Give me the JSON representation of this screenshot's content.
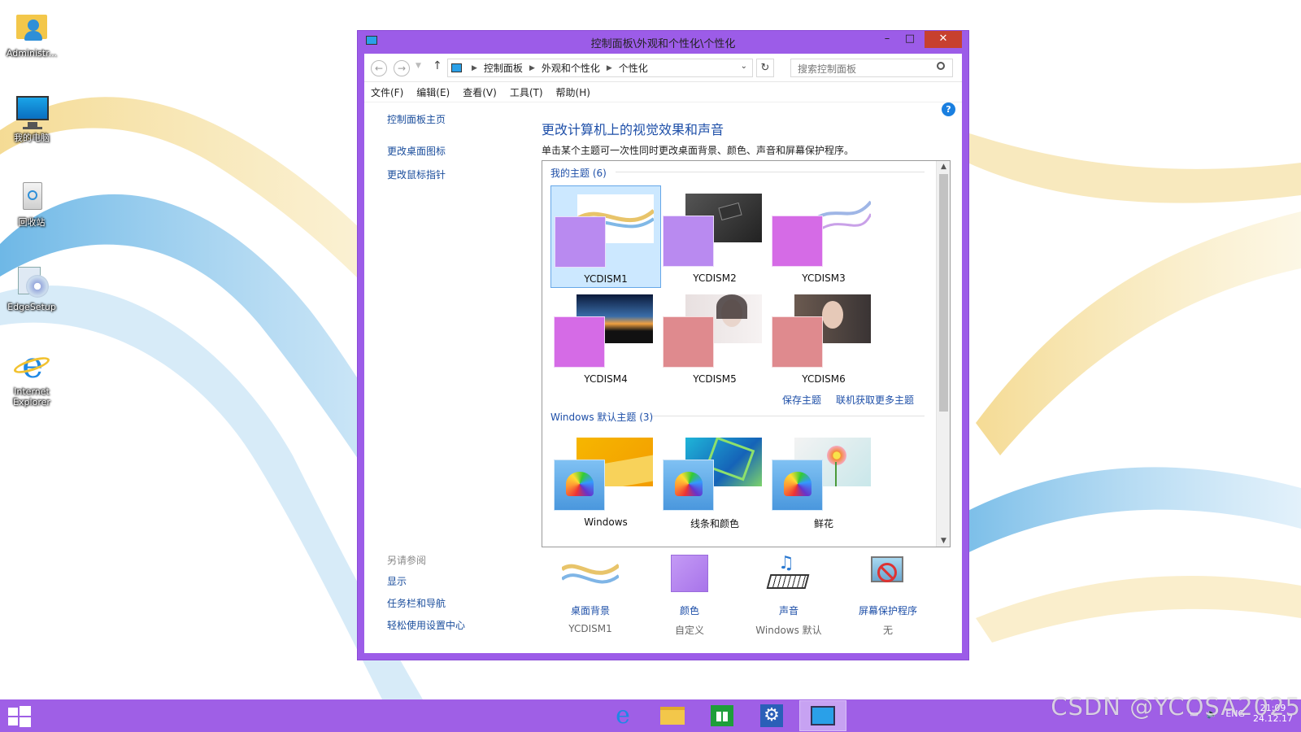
{
  "desktop": {
    "icons": [
      {
        "label": "Administr..."
      },
      {
        "label": "我的电脑"
      },
      {
        "label": "回收站"
      },
      {
        "label": "EdgeSetup"
      },
      {
        "label": "Internet Explorer"
      }
    ]
  },
  "window": {
    "title": "控制面板\\外观和个性化\\个性化",
    "controls": {
      "minimize": "–",
      "maximize": "□",
      "close": "✕"
    },
    "address": {
      "crumbs": [
        "控制面板",
        "外观和个性化",
        "个性化"
      ]
    },
    "search": {
      "placeholder": "搜索控制面板"
    },
    "menu": [
      "文件(F)",
      "编辑(E)",
      "查看(V)",
      "工具(T)",
      "帮助(H)"
    ],
    "left_links": [
      "控制面板主页",
      "更改桌面图标",
      "更改鼠标指针"
    ],
    "see_also": {
      "header": "另请参阅",
      "links": [
        "显示",
        "任务栏和导航",
        "轻松使用设置中心"
      ]
    },
    "main": {
      "title": "更改计算机上的视觉效果和声音",
      "description": "单击某个主题可一次性同时更改桌面背景、颜色、声音和屏幕保护程序。"
    },
    "my_themes": {
      "header": "我的主题 (6)",
      "themes": [
        {
          "name": "YCDISM1",
          "color": "#b98af0",
          "selected": true
        },
        {
          "name": "YCDISM2",
          "color": "#b98af0",
          "selected": false
        },
        {
          "name": "YCDISM3",
          "color": "#d56be6",
          "selected": false
        },
        {
          "name": "YCDISM4",
          "color": "#d56be6",
          "selected": false
        },
        {
          "name": "YCDISM5",
          "color": "#df8a8e",
          "selected": false
        },
        {
          "name": "YCDISM6",
          "color": "#df8a8e",
          "selected": false
        }
      ],
      "save_link": "保存主题",
      "more_link": "联机获取更多主题"
    },
    "default_themes": {
      "header": "Windows 默认主题 (3)",
      "themes": [
        {
          "name": "Windows"
        },
        {
          "name": "线条和颜色"
        },
        {
          "name": "鲜花"
        }
      ]
    },
    "settings": [
      {
        "label": "桌面背景",
        "value": "YCDISM1"
      },
      {
        "label": "颜色",
        "value": "自定义"
      },
      {
        "label": "声音",
        "value": "Windows 默认"
      },
      {
        "label": "屏幕保护程序",
        "value": "无"
      }
    ],
    "help": "?"
  },
  "taskbar": {
    "tray": {
      "lang": "ENG",
      "time": "21:09",
      "date": "24.12.17"
    }
  },
  "watermark": "CSDN @YCOSA2025",
  "colors": {
    "accent": "#9c5ce8",
    "taskbar": "#9f5fe6",
    "link": "#1e4fa8",
    "close": "#c7402f"
  }
}
